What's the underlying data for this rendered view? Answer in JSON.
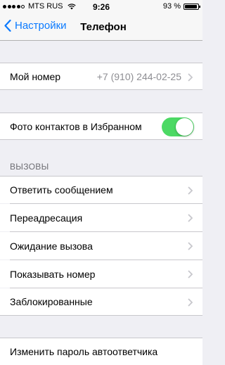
{
  "status_bar": {
    "carrier": "MTS RUS",
    "time": "9:26",
    "battery_percent": "93 %",
    "battery_level": 0.93,
    "signal_bars_filled": 4,
    "signal_bars_total": 5
  },
  "navbar": {
    "back_label": "Настройки",
    "title": "Телефон"
  },
  "my_number": {
    "label": "Мой номер",
    "value": "+7 (910) 244-02-25"
  },
  "favorites_photos": {
    "label": "Фото контактов в Избранном",
    "enabled": true
  },
  "calls_section": {
    "header": "ВЫЗОВЫ",
    "items": [
      {
        "label": "Ответить сообщением"
      },
      {
        "label": "Переадресация"
      },
      {
        "label": "Ожидание вызова"
      },
      {
        "label": "Показывать номер"
      },
      {
        "label": "Заблокированные"
      }
    ]
  },
  "voicemail": {
    "label": "Изменить пароль автоответчика"
  },
  "colors": {
    "accent": "#0a7aff",
    "toggle_on": "#4cd964",
    "background": "#efeff4"
  }
}
